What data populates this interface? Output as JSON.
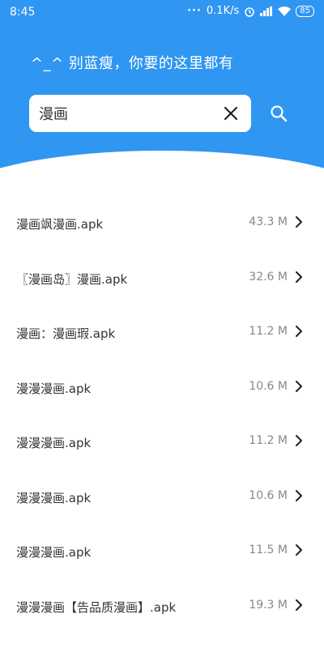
{
  "status_bar": {
    "time": "8:45",
    "net_speed": "0.1K/s",
    "battery": "85"
  },
  "header": {
    "slogan": "^_^ 别蓝瘦，你要的这里都有"
  },
  "search": {
    "query": "漫画"
  },
  "files": [
    {
      "name": "漫画飒漫画.apk",
      "size": "43.3 M"
    },
    {
      "name": "〖漫画岛〗漫画.apk",
      "size": "32.6 M"
    },
    {
      "name": "漫画：漫画瑕.apk",
      "size": "11.2 M"
    },
    {
      "name": "漫漫漫画.apk",
      "size": "10.6 M"
    },
    {
      "name": "漫漫漫画.apk",
      "size": "11.2 M"
    },
    {
      "name": "漫漫漫画.apk",
      "size": "10.6 M"
    },
    {
      "name": "漫漫漫画.apk",
      "size": "11.5 M"
    },
    {
      "name": "漫漫漫画【告品质漫画】.apk",
      "size": "19.3 M"
    }
  ],
  "colors": {
    "header": "#2f96f1"
  }
}
